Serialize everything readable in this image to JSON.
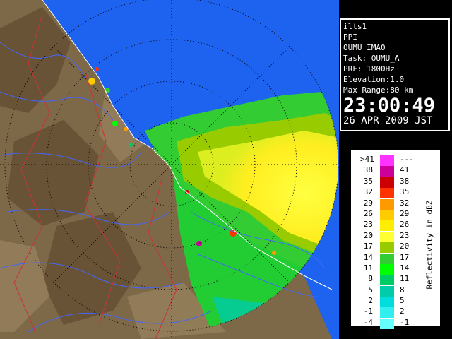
{
  "info": {
    "station": "ilts1",
    "product": "PPI",
    "site": "OUMU_IMA0",
    "task": "Task: OUMU_A",
    "prf": "PRF: 1800Hz",
    "elevation": "Elevation:1.0",
    "max_range": "Max Range:80 km",
    "time": "23:00:49",
    "date": "26 APR 2009 JST"
  },
  "legend": {
    "title": "Reflectivity in dBZ",
    "rows": [
      {
        "left": ">41",
        "right": "---",
        "color": "#ff33ff"
      },
      {
        "left": "38",
        "right": "41",
        "color": "#cc0099"
      },
      {
        "left": "35",
        "right": "38",
        "color": "#cc0000"
      },
      {
        "left": "32",
        "right": "35",
        "color": "#ff3300"
      },
      {
        "left": "29",
        "right": "32",
        "color": "#ff9900"
      },
      {
        "left": "26",
        "right": "29",
        "color": "#ffcc00"
      },
      {
        "left": "23",
        "right": "26",
        "color": "#ffee00"
      },
      {
        "left": "20",
        "right": "23",
        "color": "#ffff33"
      },
      {
        "left": "17",
        "right": "20",
        "color": "#99cc00"
      },
      {
        "left": "14",
        "right": "17",
        "color": "#33cc33"
      },
      {
        "left": "11",
        "right": "14",
        "color": "#00ff00"
      },
      {
        "left": "8",
        "right": "11",
        "color": "#00cc66"
      },
      {
        "left": "5",
        "right": "8",
        "color": "#00ccaa"
      },
      {
        "left": "2",
        "right": "5",
        "color": "#00dddd"
      },
      {
        "left": "-1",
        "right": "2",
        "color": "#33eeee"
      },
      {
        "left": "-4",
        "right": "-1",
        "color": "#66ffff"
      }
    ]
  },
  "colors": {
    "sea": "#1e62f0",
    "ocean_dark": "#1844c8",
    "land": "#8a7350",
    "land_dark": "#5a4228",
    "rivers": "#4466ff",
    "borders": "#cc3333"
  }
}
